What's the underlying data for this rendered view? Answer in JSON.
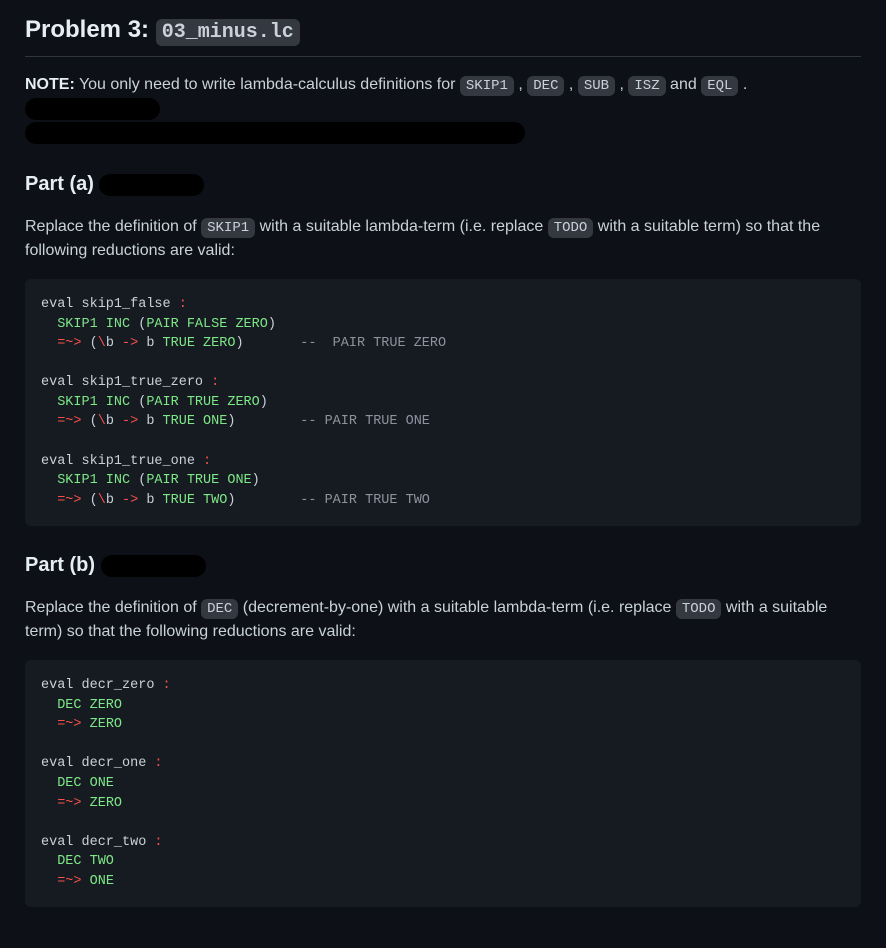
{
  "problem": {
    "label": "Problem 3:",
    "filename": "03_minus.lc"
  },
  "note": {
    "label": "NOTE:",
    "text_before": " You only need to write lambda-calculus definitions for ",
    "ids": [
      "SKIP1",
      "DEC",
      "SUB",
      "ISZ",
      "EQL"
    ],
    "sep": " , ",
    "and": " and ",
    "period": " ."
  },
  "part_a": {
    "heading": "Part (a)",
    "para_prefix": "Replace the definition of ",
    "code1": "SKIP1",
    "mid": " with a suitable lambda-term (i.e. replace ",
    "code2": "TODO",
    "suffix": " with a suitable term) so that the following reductions are valid:",
    "code": {
      "l01_a": "eval skip1_false ",
      "l01_b": ":",
      "l02_a": "  ",
      "l02_b": "SKIP1 INC",
      "l02_c": " (",
      "l02_d": "PAIR FALSE ZERO",
      "l02_e": ")",
      "l03_a": "  ",
      "l03_b": "=~>",
      "l03_c": " (",
      "l03_d": "\\",
      "l03_e": "b ",
      "l03_f": "->",
      "l03_g": " b ",
      "l03_h": "TRUE ZERO",
      "l03_i": ")       ",
      "l03_j": "--  PAIR TRUE ZERO",
      "l05_a": "eval skip1_true_zero ",
      "l05_b": ":",
      "l06_a": "  ",
      "l06_b": "SKIP1 INC",
      "l06_c": " (",
      "l06_d": "PAIR TRUE ZERO",
      "l06_e": ")",
      "l07_a": "  ",
      "l07_b": "=~>",
      "l07_c": " (",
      "l07_d": "\\",
      "l07_e": "b ",
      "l07_f": "->",
      "l07_g": " b ",
      "l07_h": "TRUE ONE",
      "l07_i": ")        ",
      "l07_j": "-- PAIR TRUE ONE",
      "l09_a": "eval skip1_true_one ",
      "l09_b": ":",
      "l10_a": "  ",
      "l10_b": "SKIP1 INC",
      "l10_c": " (",
      "l10_d": "PAIR TRUE ONE",
      "l10_e": ")",
      "l11_a": "  ",
      "l11_b": "=~>",
      "l11_c": " (",
      "l11_d": "\\",
      "l11_e": "b ",
      "l11_f": "->",
      "l11_g": " b ",
      "l11_h": "TRUE TWO",
      "l11_i": ")        ",
      "l11_j": "-- PAIR TRUE TWO"
    }
  },
  "part_b": {
    "heading": "Part (b)",
    "para_prefix": "Replace the definition of ",
    "code1": "DEC",
    "mid": " (decrement-by-one) with a suitable lambda-term (i.e. replace ",
    "code2": "TODO",
    "suffix": " with a suitable term) so that the following reductions are valid:",
    "code": {
      "l01_a": "eval decr_zero ",
      "l01_b": ":",
      "l02_a": "  ",
      "l02_b": "DEC ZERO",
      "l03_a": "  ",
      "l03_b": "=~>",
      "l03_c": " ",
      "l03_d": "ZERO",
      "l05_a": "eval decr_one ",
      "l05_b": ":",
      "l06_a": "  ",
      "l06_b": "DEC ONE",
      "l07_a": "  ",
      "l07_b": "=~>",
      "l07_c": " ",
      "l07_d": "ZERO",
      "l09_a": "eval decr_two ",
      "l09_b": ":",
      "l10_a": "  ",
      "l10_b": "DEC TWO",
      "l11_a": "  ",
      "l11_b": "=~>",
      "l11_c": " ",
      "l11_d": "ONE"
    }
  }
}
